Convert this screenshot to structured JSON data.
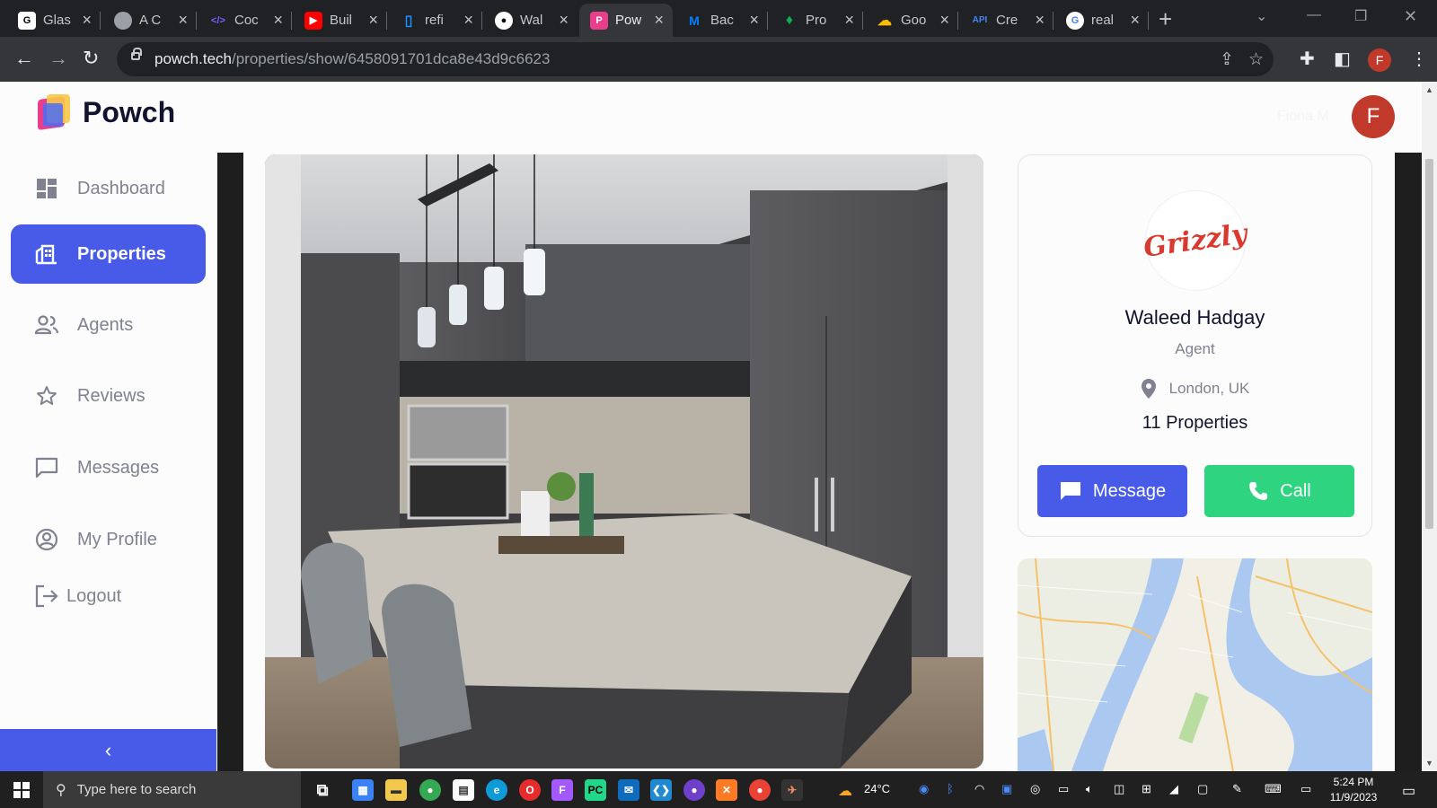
{
  "browser": {
    "tabs": [
      {
        "title": "Glas",
        "icon": "glassdoor-icon",
        "color": "#ffffff"
      },
      {
        "title": "A C",
        "icon": "globe-icon",
        "color": "#9aa0a6"
      },
      {
        "title": "Coc",
        "icon": "code-icon",
        "color": "#7b61ff"
      },
      {
        "title": "Buil",
        "icon": "youtube-icon",
        "color": "#ff0000"
      },
      {
        "title": "refi",
        "icon": "refine-icon",
        "color": "#1890ff"
      },
      {
        "title": "Wal",
        "icon": "github-icon",
        "color": "#ffffff"
      },
      {
        "title": "Pow",
        "icon": "powch-icon",
        "color": "#e83e8c"
      },
      {
        "title": "Bac",
        "icon": "mui-icon",
        "color": "#007fff"
      },
      {
        "title": "Pro",
        "icon": "mongodb-icon",
        "color": "#13aa52"
      },
      {
        "title": "Goo",
        "icon": "google-cloud-icon",
        "color": "#fbbc04"
      },
      {
        "title": "Cre",
        "icon": "api-icon",
        "color": "#4285f4"
      },
      {
        "title": "real",
        "icon": "google-icon",
        "color": "#4285f4"
      }
    ],
    "url_host": "powch.tech",
    "url_path": "/properties/show/6458091701dca8e43d9c6623"
  },
  "app": {
    "name": "Powch",
    "user_name": "Fiona M",
    "user_initial": "F",
    "accent": "#475be8"
  },
  "sidebar": {
    "items": [
      {
        "label": "Dashboard",
        "icon": "dashboard-icon"
      },
      {
        "label": "Properties",
        "icon": "properties-icon"
      },
      {
        "label": "Agents",
        "icon": "agents-icon"
      },
      {
        "label": "Reviews",
        "icon": "star-icon"
      },
      {
        "label": "Messages",
        "icon": "message-icon"
      },
      {
        "label": "My Profile",
        "icon": "profile-icon"
      }
    ],
    "logout_label": "Logout"
  },
  "agent": {
    "logo_text": "Grizzly",
    "name": "Waleed Hadgay",
    "role": "Agent",
    "location": "London, UK",
    "properties": "11 Properties",
    "message_label": "Message",
    "call_label": "Call",
    "message_color": "#475be8",
    "call_color": "#2ed480"
  },
  "taskbar": {
    "search_placeholder": "Type here to search",
    "weather": "24°C",
    "time": "5:24 PM",
    "date": "11/9/2023"
  }
}
